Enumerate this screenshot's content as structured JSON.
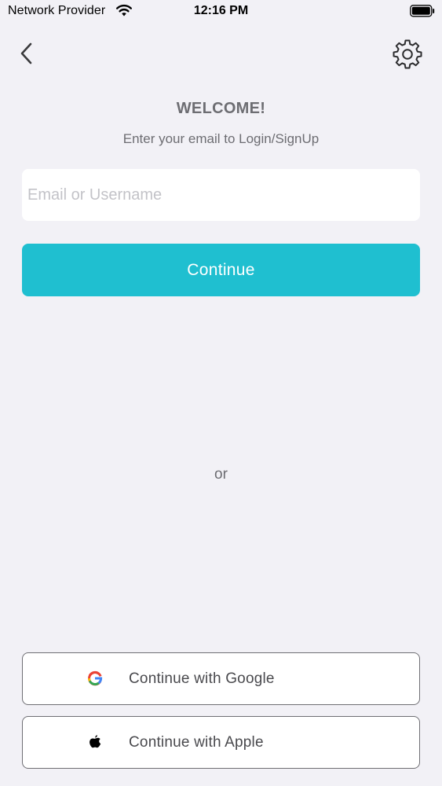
{
  "status_bar": {
    "carrier": "Network Provider",
    "time": "12:16 PM"
  },
  "header": {
    "title": "WELCOME!",
    "subtitle": "Enter your email to Login/SignUp"
  },
  "form": {
    "email_placeholder": "Email or Username",
    "email_value": "",
    "continue_label": "Continue"
  },
  "divider": {
    "or_label": "or"
  },
  "social": {
    "google_label": "Continue with Google",
    "apple_label": "Continue with Apple"
  },
  "colors": {
    "background": "#f2f1f6",
    "accent": "#1fbfd0",
    "text_muted": "#6d6d72"
  },
  "icons": {
    "back": "chevron-left-icon",
    "settings": "gear-icon",
    "google": "google-logo-icon",
    "apple": "apple-logo-icon"
  }
}
